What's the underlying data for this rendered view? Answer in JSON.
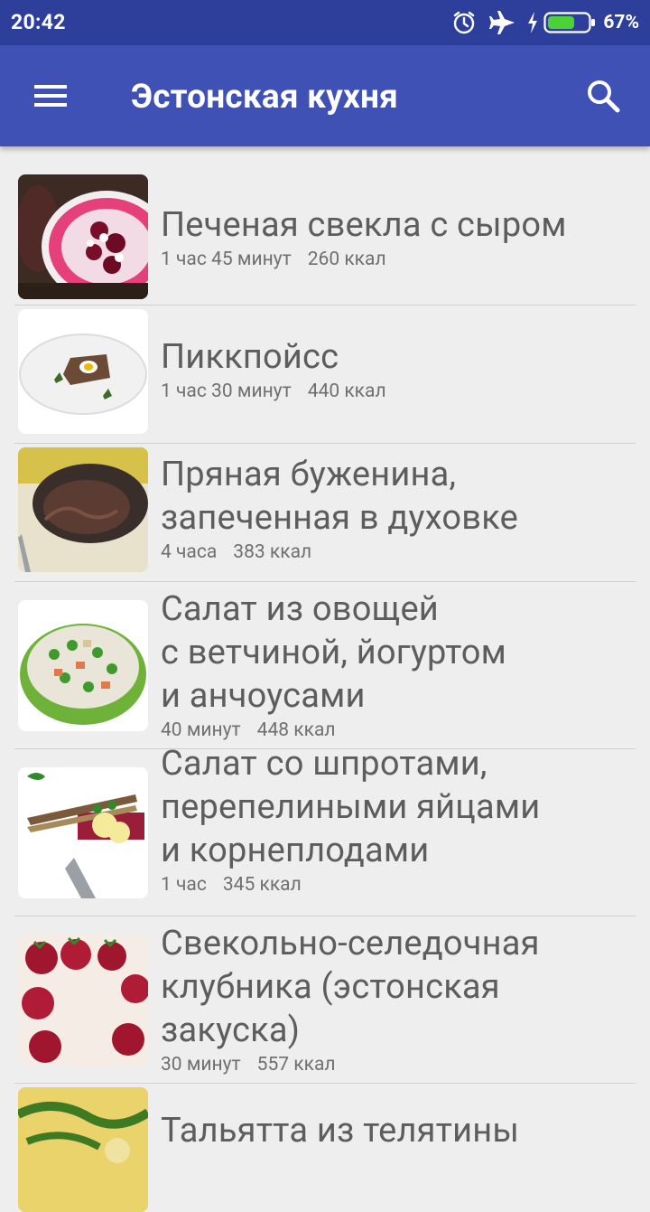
{
  "status_bar": {
    "time": "20:42",
    "icons": [
      "alarm-icon",
      "airplane-mode-icon",
      "charging-icon",
      "battery-icon"
    ],
    "battery_percent": "67%",
    "battery_level": 0.67,
    "background_color": "#2d3f9a"
  },
  "app_bar": {
    "title": "Эстонская кухня",
    "menu_icon": "menu-icon",
    "search_icon": "search-icon",
    "background_color": "#3f51b5"
  },
  "recipes": [
    {
      "title_lines": [
        "Печеная свекла с сыром"
      ],
      "time": "1 час 45 минут",
      "calories": "260 ккал"
    },
    {
      "title_lines": [
        "Пиккпойсс"
      ],
      "time": "1 час 30 минут",
      "calories": "440 ккал"
    },
    {
      "title_lines": [
        "Пряная буженина,",
        "запеченная в духовке"
      ],
      "time": "4 часа",
      "calories": "383 ккал"
    },
    {
      "title_lines": [
        "Салат из овощей",
        "с ветчиной, йогуртом",
        "и анчоусами"
      ],
      "time": "40 минут",
      "calories": "448 ккал"
    },
    {
      "title_lines": [
        "Салат со шпротами,",
        "перепелиными яйцами",
        "и корнеплодами"
      ],
      "time": "1 час",
      "calories": "345 ккал"
    },
    {
      "title_lines": [
        "Свекольно-селедочная",
        "клубника (эстонская",
        "закуска)"
      ],
      "time": "30 минут",
      "calories": "557 ккал"
    },
    {
      "title_lines": [
        "Тальятта из телятины"
      ],
      "time": "",
      "calories": ""
    }
  ]
}
